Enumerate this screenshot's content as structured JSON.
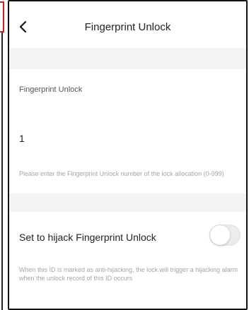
{
  "header": {
    "title": "Fingerprint Unlock",
    "back_icon": "chevron-left-icon"
  },
  "id_field": {
    "label": "Fingerprint Unlock",
    "value": "1",
    "help": "Please enter the Fingerprint Unlock number of the lock allocation (0-999)"
  },
  "hijack": {
    "label": "Set to hijack Fingerprint Unlock",
    "enabled": false,
    "help": "When this ID is marked as anti-hijacking, the lock will trigger a hijacking alarm when the unlock record of this ID occurs"
  },
  "colors": {
    "background": "#f3f3f5",
    "card": "#ffffff",
    "text_primary": "#222222",
    "text_hint": "#a5a5a8",
    "toggle_off": "#ececee",
    "frame_accent": "#cc1f1f"
  }
}
